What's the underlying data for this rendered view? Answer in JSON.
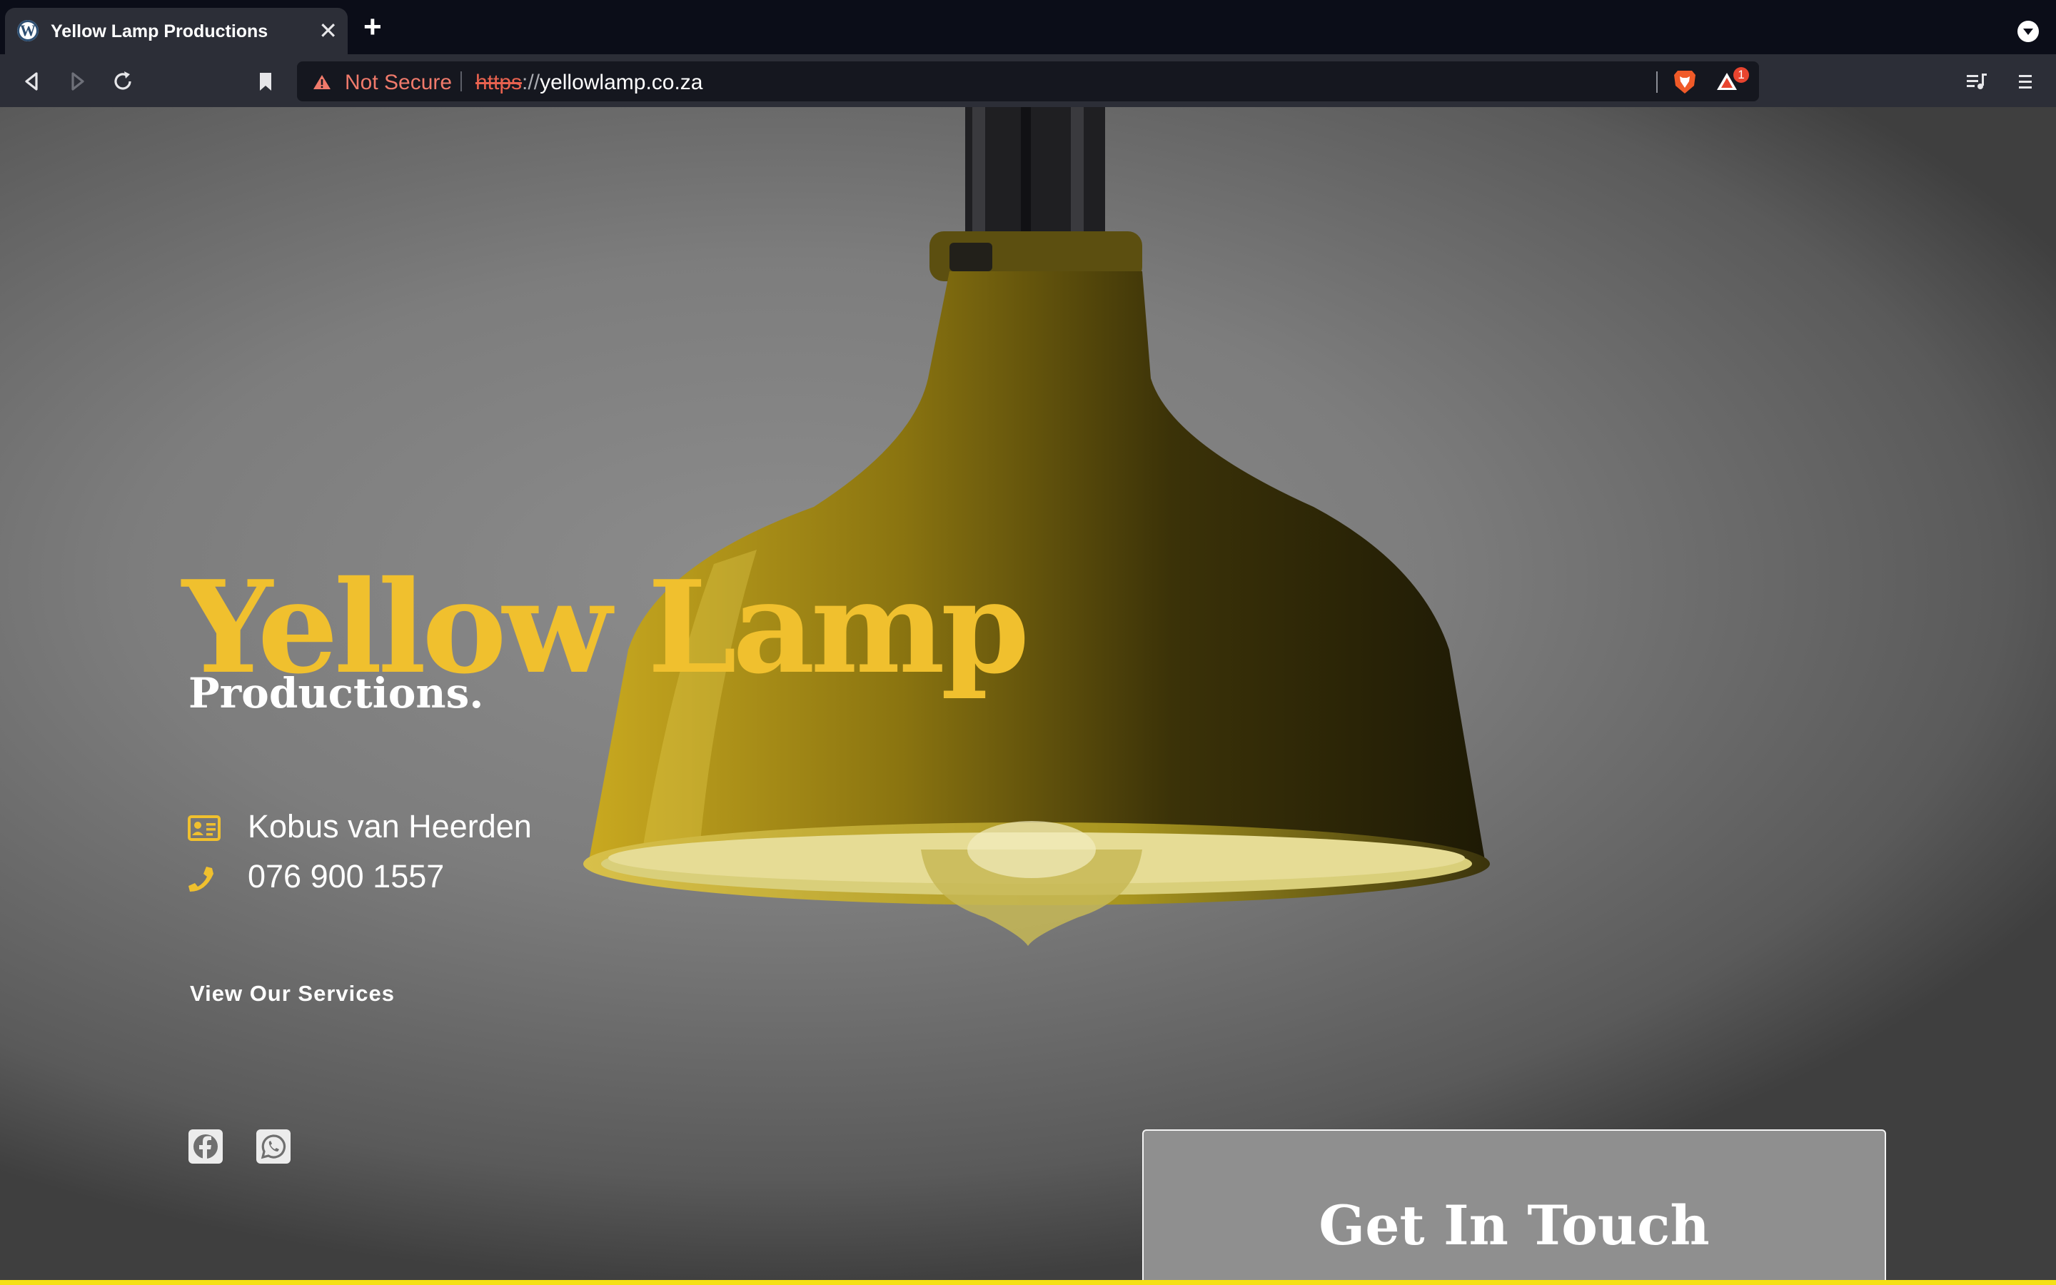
{
  "browser": {
    "tab": {
      "title": "Yellow Lamp Productions",
      "favicon": "wordpress-icon"
    },
    "new_tab_icon": "plus-icon",
    "address_bar": {
      "security_label": "Not Secure",
      "url_scheme": "https",
      "url_separator": "://",
      "url_host": "yellowlamp.co.za"
    },
    "rewards_badge_count": "1",
    "accent_warning_color": "#f07a6b"
  },
  "hero": {
    "title": "Yellow Lamp",
    "subtitle": "Productions.",
    "contacts": [
      {
        "icon": "id-card-icon",
        "text": "Kobus van Heerden"
      },
      {
        "icon": "phone-icon",
        "text": "076 900 1557"
      }
    ],
    "cta_label": "View Our Services",
    "social": [
      "facebook-icon",
      "whatsapp-icon"
    ]
  },
  "contact_card": {
    "title": "Get In Touch"
  },
  "colors": {
    "brand_yellow": "#f0c02e",
    "bottom_bar": "#f5e015"
  }
}
